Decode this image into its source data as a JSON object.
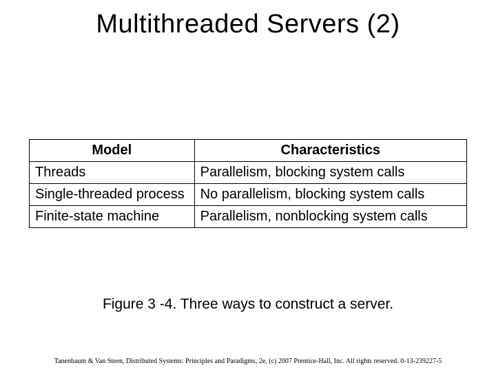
{
  "title": "Multithreaded Servers (2)",
  "table": {
    "headers": {
      "model": "Model",
      "characteristics": "Characteristics"
    },
    "rows": [
      {
        "model": "Threads",
        "characteristics": "Parallelism, blocking system calls"
      },
      {
        "model": "Single-threaded process",
        "characteristics": "No parallelism, blocking system calls"
      },
      {
        "model": "Finite-state machine",
        "characteristics": "Parallelism, nonblocking system calls"
      }
    ]
  },
  "caption": "Figure 3 -4. Three ways to construct a server.",
  "footer": "Tanenbaum & Van Steen, Distributed Systems: Principles and Paradigms, 2e, (c) 2007 Prentice-Hall, Inc. All rights reserved. 0-13-239227-5"
}
